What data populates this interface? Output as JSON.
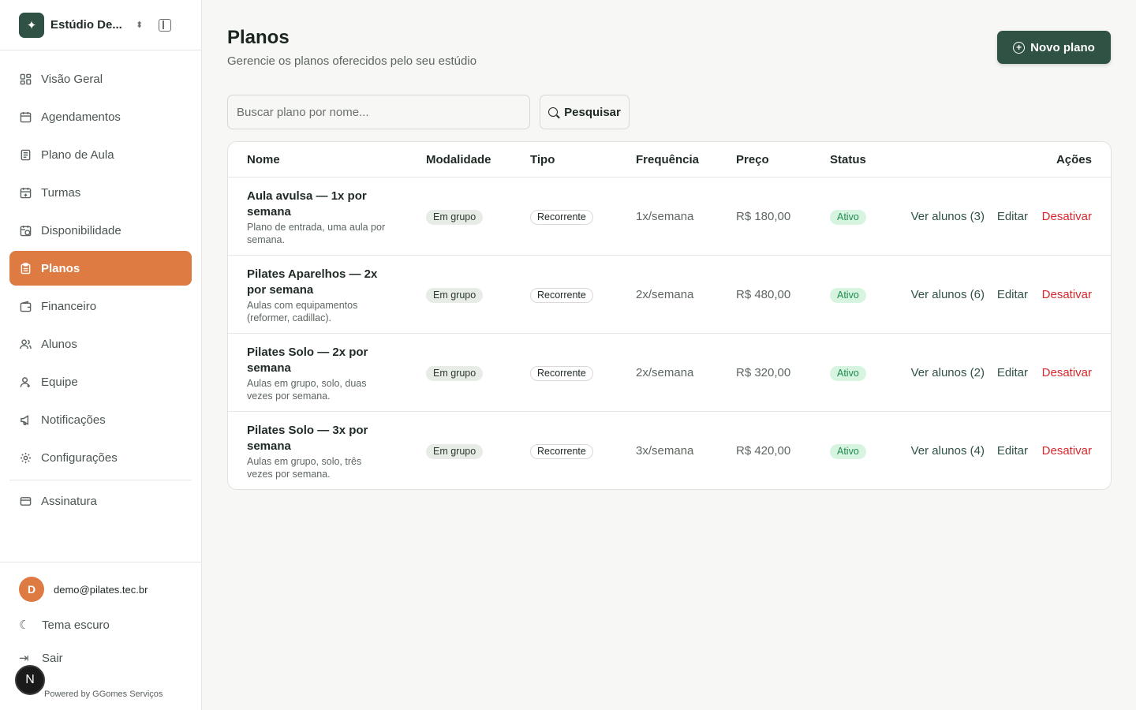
{
  "brand": {
    "name": "Estúdio De..."
  },
  "nav": [
    {
      "label": "Visão Geral",
      "icon": "dashboard-icon"
    },
    {
      "label": "Agendamentos",
      "icon": "calendar-icon"
    },
    {
      "label": "Plano de Aula",
      "icon": "document-icon"
    },
    {
      "label": "Turmas",
      "icon": "calendar-plus-icon"
    },
    {
      "label": "Disponibilidade",
      "icon": "calendar-clock-icon"
    },
    {
      "label": "Planos",
      "icon": "clipboard-icon",
      "active": true
    },
    {
      "label": "Financeiro",
      "icon": "wallet-icon"
    },
    {
      "label": "Alunos",
      "icon": "users-icon"
    },
    {
      "label": "Equipe",
      "icon": "user-icon"
    },
    {
      "label": "Notificações",
      "icon": "megaphone-icon"
    },
    {
      "label": "Configurações",
      "icon": "gear-icon"
    }
  ],
  "nav_extra": {
    "label": "Assinatura",
    "icon": "credit-card-icon"
  },
  "footer": {
    "avatar_letter": "D",
    "email": "demo@pilates.tec.br",
    "theme_label": "Tema escuro",
    "logout_label": "Sair",
    "powered": "Powered by GGomes Serviços",
    "badge_letter": "N"
  },
  "page": {
    "title": "Planos",
    "subtitle": "Gerencie os planos oferecidos pelo seu estúdio",
    "new_button": "Novo plano"
  },
  "search": {
    "placeholder": "Buscar plano por nome...",
    "button": "Pesquisar"
  },
  "table": {
    "headers": {
      "nome": "Nome",
      "modalidade": "Modalidade",
      "tipo": "Tipo",
      "frequencia": "Frequência",
      "preco": "Preço",
      "status": "Status",
      "acoes": "Ações"
    },
    "rows": [
      {
        "name": "Aula avulsa — 1x por semana",
        "desc": "Plano de entrada, uma aula por semana.",
        "modalidade": "Em grupo",
        "tipo": "Recorrente",
        "frequencia": "1x/semana",
        "preco": "R$ 180,00",
        "status": "Ativo",
        "ver": "Ver alunos (3)",
        "editar": "Editar",
        "desativar": "Desativar"
      },
      {
        "name": "Pilates Aparelhos — 2x por semana",
        "desc": "Aulas com equipamentos (reformer, cadillac).",
        "modalidade": "Em grupo",
        "tipo": "Recorrente",
        "frequencia": "2x/semana",
        "preco": "R$ 480,00",
        "status": "Ativo",
        "ver": "Ver alunos (6)",
        "editar": "Editar",
        "desativar": "Desativar"
      },
      {
        "name": "Pilates Solo — 2x por semana",
        "desc": "Aulas em grupo, solo, duas vezes por semana.",
        "modalidade": "Em grupo",
        "tipo": "Recorrente",
        "frequencia": "2x/semana",
        "preco": "R$ 320,00",
        "status": "Ativo",
        "ver": "Ver alunos (2)",
        "editar": "Editar",
        "desativar": "Desativar"
      },
      {
        "name": "Pilates Solo — 3x por semana",
        "desc": "Aulas em grupo, solo, três vezes por semana.",
        "modalidade": "Em grupo",
        "tipo": "Recorrente",
        "frequencia": "3x/semana",
        "preco": "R$ 420,00",
        "status": "Ativo",
        "ver": "Ver alunos (4)",
        "editar": "Editar",
        "desativar": "Desativar"
      }
    ]
  },
  "colors": {
    "primary": "#2f5244",
    "accent": "#dd7b43",
    "danger": "#d6272d",
    "success_bg": "#d7f4e1",
    "success_text": "#1d8a4d"
  }
}
